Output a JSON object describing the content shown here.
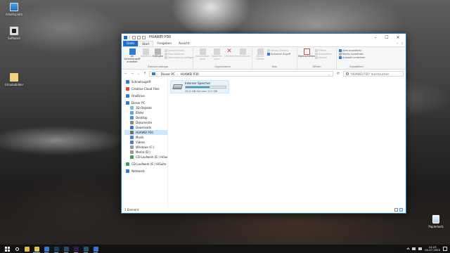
{
  "desktop": {
    "icons": [
      {
        "label": "Arbeitsplatz",
        "icon": "this-pc-icon"
      },
      {
        "label": "Software",
        "icon": "app-icon"
      },
      {
        "label": "Urlaubsbilder",
        "icon": "file-icon"
      },
      {
        "label": "Papierkorb",
        "icon": "recycle-bin-icon"
      }
    ]
  },
  "window": {
    "title": "HUAWEI P30",
    "controls": {
      "minimize": "–",
      "maximize": "☐",
      "close": "✕"
    },
    "tabs": [
      "Datei",
      "Start",
      "Freigeben",
      "Ansicht"
    ],
    "active_tab": "Start",
    "ribbon": {
      "clipboard": {
        "label": "Zwischenablage",
        "pin": "An Schnellzugriff anheften",
        "copy": "Kopieren",
        "paste": "Einfügen",
        "cut": "Ausschneiden",
        "copy_path": "Pfad kopieren",
        "paste_shortcut": "Verknüpfung einfügen"
      },
      "organize": {
        "label": "Organisieren",
        "move_to": "Verschieben nach",
        "copy_to": "Kopieren nach",
        "delete": "Löschen",
        "rename": "Umbenennen"
      },
      "new": {
        "label": "Neu",
        "new_folder": "Neuer Ordner",
        "new_item": "Neues Element",
        "easy_access": "Einfacher Zugriff"
      },
      "open": {
        "label": "Öffnen",
        "properties": "Eigenschaften",
        "open": "Öffnen",
        "edit": "Bearbeiten",
        "history": "Verlauf"
      },
      "select": {
        "label": "Auswählen",
        "select_all": "Alles auswählen",
        "select_none": "Nichts auswählen",
        "invert": "Auswahl umkehren"
      }
    },
    "address": {
      "back": "←",
      "forward": "→",
      "recent": "⌄",
      "up": "↑",
      "crumbs": [
        "Dieser PC",
        "HUAWEI P30"
      ],
      "separator": "›",
      "dropdown": "⌄",
      "refresh": "⟳",
      "search_placeholder": "\"HUAWEI P30\" durchsuchen"
    },
    "nav_pane": [
      {
        "label": "Schnellzugriff",
        "icon": "star-icon",
        "color": "#2f7bd2",
        "level": 0
      },
      {
        "label": "Creative Cloud Files",
        "icon": "cloud-icon",
        "color": "#e8463c",
        "level": 0
      },
      {
        "label": "OneDrive",
        "icon": "onedrive-icon",
        "color": "#2f7bd2",
        "level": 0
      },
      {
        "label": "Dieser PC",
        "icon": "this-pc-icon",
        "color": "#2f7bd2",
        "level": 0
      },
      {
        "label": "3D-Objekte",
        "icon": "cube-icon",
        "color": "#7dbbe8",
        "level": 1
      },
      {
        "label": "Bilder",
        "icon": "pictures-icon",
        "color": "#58a6e0",
        "level": 1
      },
      {
        "label": "Desktop",
        "icon": "desktop-icon",
        "color": "#4a90d8",
        "level": 1
      },
      {
        "label": "Dokumente",
        "icon": "documents-icon",
        "color": "#8a8a8a",
        "level": 1
      },
      {
        "label": "Downloads",
        "icon": "download-icon",
        "color": "#2f7bd2",
        "level": 1
      },
      {
        "label": "HUAWEI P30",
        "icon": "phone-icon",
        "color": "#6f6f6f",
        "level": 1,
        "selected": true
      },
      {
        "label": "Musik",
        "icon": "music-icon",
        "color": "#3f86d6",
        "level": 1
      },
      {
        "label": "Videos",
        "icon": "video-icon",
        "color": "#5a6fd8",
        "level": 1
      },
      {
        "label": "Windows (C:)",
        "icon": "drive-icon",
        "color": "#9a9a9a",
        "level": 1
      },
      {
        "label": "Media (D:)",
        "icon": "drive-icon",
        "color": "#9a9a9a",
        "level": 1
      },
      {
        "label": "CD-Laufwerk (E:) HiSuite",
        "icon": "cd-icon",
        "color": "#3aa356",
        "level": 1
      },
      {
        "label": "CD-Laufwerk (E:) HiSuite",
        "icon": "cd-icon",
        "color": "#3aa356",
        "level": 0
      },
      {
        "label": "Netzwerk",
        "icon": "network-icon",
        "color": "#2f7bd2",
        "level": 0
      }
    ],
    "content": {
      "drive_name": "Interner Speicher",
      "drive_free": "45,5 GB frei von 111 GB",
      "used_fraction": 0.59
    },
    "status": {
      "count": "1 Element"
    }
  },
  "taskbar": {
    "apps": [
      {
        "icon": "search-icon",
        "color": "#ffffff"
      },
      {
        "icon": "chrome-icon",
        "color": "#e8b54a"
      },
      {
        "icon": "explorer-icon",
        "color": "#e8c04a",
        "active": true
      },
      {
        "icon": "edge-icon",
        "color": "#2f7bd2"
      },
      {
        "icon": "photoshop-icon",
        "color": "#1d3a5e"
      },
      {
        "icon": "lightroom-icon",
        "color": "#2b4a6b"
      },
      {
        "icon": "premiere-icon",
        "color": "#2a1f4f"
      },
      {
        "icon": "media-encoder-icon",
        "color": "#1e5a73"
      },
      {
        "icon": "vscode-icon",
        "color": "#2f7bd2"
      }
    ],
    "time": "14:23",
    "date": "04.07.2020"
  }
}
